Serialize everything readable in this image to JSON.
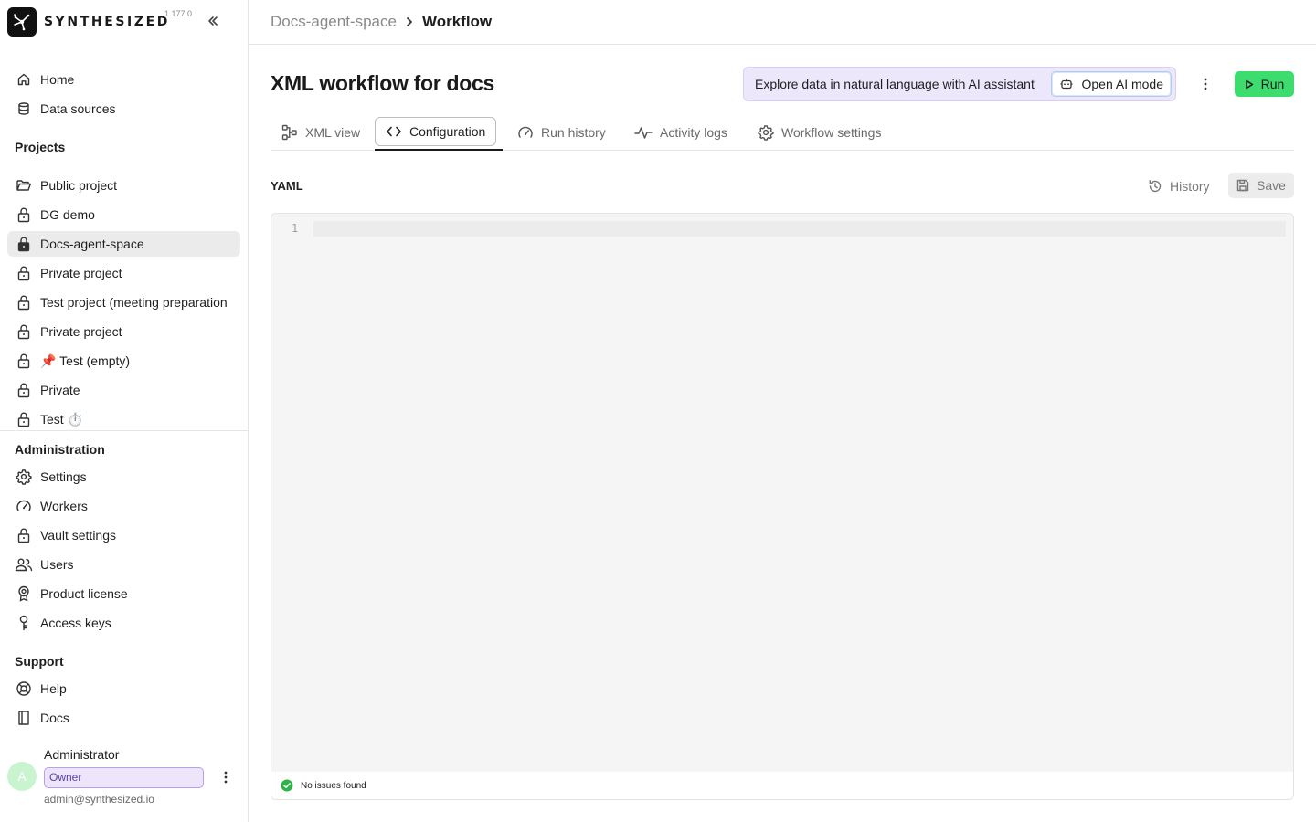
{
  "app": {
    "brand": "SYNTHESIZED",
    "version": "1.177.0"
  },
  "sidebar": {
    "top_items": [
      {
        "label": "Home",
        "icon": "home-icon"
      },
      {
        "label": "Data sources",
        "icon": "database-icon"
      }
    ],
    "projects_title": "Projects",
    "projects": [
      {
        "label": "Public project",
        "icon": "folder-open-icon"
      },
      {
        "label": "DG demo",
        "icon": "lock-icon"
      },
      {
        "label": "Docs-agent-space",
        "icon": "lock-filled-icon",
        "active": true
      },
      {
        "label": "Private project",
        "icon": "lock-icon"
      },
      {
        "label": "Test project (meeting preparation",
        "icon": "lock-icon"
      },
      {
        "label": "Private project",
        "icon": "lock-icon"
      },
      {
        "label": "📌 Test (empty)",
        "icon": "lock-icon"
      },
      {
        "label": "Private",
        "icon": "lock-icon"
      },
      {
        "label": "Test ⏱️",
        "icon": "lock-icon"
      }
    ],
    "admin_title": "Administration",
    "admin_items": [
      {
        "label": "Settings",
        "icon": "gear-icon"
      },
      {
        "label": "Workers",
        "icon": "gauge-icon"
      },
      {
        "label": "Vault settings",
        "icon": "lock-icon"
      },
      {
        "label": "Users",
        "icon": "users-icon"
      },
      {
        "label": "Product license",
        "icon": "award-icon"
      },
      {
        "label": "Access keys",
        "icon": "key-icon"
      }
    ],
    "support_title": "Support",
    "support_items": [
      {
        "label": "Help",
        "icon": "lifebuoy-icon"
      },
      {
        "label": "Docs",
        "icon": "book-icon"
      }
    ],
    "user": {
      "avatar_letter": "A",
      "name": "Administrator",
      "role": "Owner",
      "email": "admin@synthesized.io"
    }
  },
  "breadcrumb": {
    "parent": "Docs-agent-space",
    "current": "Workflow"
  },
  "main": {
    "title": "XML workflow for docs",
    "ai_banner_text": "Explore data in natural language with AI assistant",
    "ai_button_label": "Open AI mode",
    "run_label": "Run",
    "tabs": [
      {
        "label": "XML view",
        "icon": "diagram-icon"
      },
      {
        "label": "Configuration",
        "icon": "code-icon",
        "active": true
      },
      {
        "label": "Run history",
        "icon": "gauge-icon"
      },
      {
        "label": "Activity logs",
        "icon": "activity-icon"
      },
      {
        "label": "Workflow settings",
        "icon": "gear-icon"
      }
    ],
    "editor_label": "YAML",
    "history_label": "History",
    "save_label": "Save",
    "line_number": "1",
    "code_value": "",
    "status_text": "No issues found"
  },
  "colors": {
    "run_button": "#3ddc6f",
    "ai_banner": "#ece7fb",
    "role_badge": "#ede6fb",
    "status_ok": "#2fb344"
  }
}
